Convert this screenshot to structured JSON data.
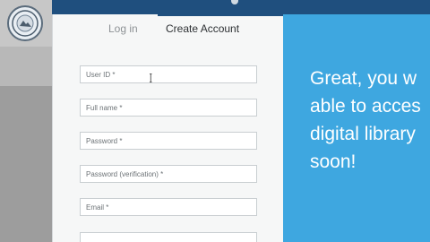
{
  "tabs": {
    "login": "Log in",
    "create_account": "Create Account"
  },
  "form": {
    "user_id": {
      "placeholder": "User ID *",
      "value": ""
    },
    "full_name": {
      "placeholder": "Full name *",
      "value": ""
    },
    "password": {
      "placeholder": "Password *",
      "value": ""
    },
    "password_verification": {
      "placeholder": "Password (verification) *",
      "value": ""
    },
    "email": {
      "placeholder": "Email *",
      "value": ""
    }
  },
  "hero": {
    "lines": [
      "Great, you w",
      "able to acces",
      "digital library",
      "soon!"
    ]
  },
  "colors": {
    "top_bar": "#1f4f7e",
    "panel_bg": "#f6f7f7",
    "hero_bg": "#3ea7e0",
    "hero_text": "#ffffff",
    "active_tab_indicator": "#1f4f7e"
  },
  "icons": {
    "logo": "seal-logo-icon",
    "cursor": "text-cursor-icon"
  }
}
